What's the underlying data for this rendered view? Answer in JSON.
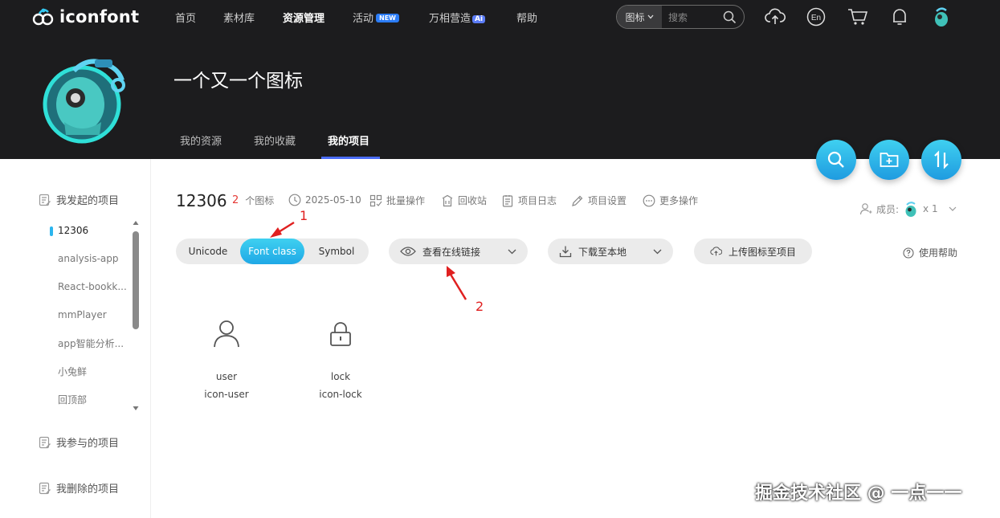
{
  "colors": {
    "nav_bg": "#1c1c1e",
    "accent_cyan": "#2bb5ee",
    "tab_underline": "#4a6cf7",
    "annotation_red": "#e02020",
    "count_red": "#e53935"
  },
  "nav": {
    "logo_text": "iconfont",
    "items": [
      "首页",
      "素材库",
      "资源管理",
      "活动",
      "万相营造",
      "帮助"
    ],
    "active_index": 2,
    "new_badge": "NEW",
    "ai_badge": "Ai",
    "search_type": "图标",
    "search_placeholder": "搜索",
    "icons": [
      "upload-icon",
      "language-en-icon",
      "cart-icon",
      "bell-icon",
      "user-avatar"
    ],
    "lang_label": "En"
  },
  "hero": {
    "title": "一个又一个图标",
    "tabs": [
      "我的资源",
      "我的收藏",
      "我的项目"
    ],
    "active_tab_index": 2
  },
  "fabs": [
    "search-icon",
    "add-folder-icon",
    "sort-icon"
  ],
  "sidebar": {
    "sections": {
      "initiated": "我发起的项目",
      "joined": "我参与的项目",
      "deleted": "我删除的项目"
    },
    "projects": [
      "12306",
      "analysis-app",
      "React-bookk...",
      "mmPlayer",
      "app智能分析...",
      "小兔鲜",
      "回顶部"
    ],
    "active_project_index": 0
  },
  "project": {
    "name": "12306",
    "icon_count": "2",
    "icon_count_label": "个图标",
    "date": "2025-05-10",
    "actions": [
      "批量操作",
      "回收站",
      "项目日志",
      "项目设置",
      "更多操作"
    ],
    "members_label": "成员:",
    "members_count": "x 1"
  },
  "toolbar": {
    "segments": [
      "Unicode",
      "Font class",
      "Symbol"
    ],
    "active_segment_index": 1,
    "view_link": "查看在线链接",
    "download": "下载至本地",
    "upload": "上传图标至项目",
    "help": "使用帮助"
  },
  "icons": [
    {
      "name": "user",
      "class": "icon-user",
      "glyph": "user-icon"
    },
    {
      "name": "lock",
      "class": "icon-lock",
      "glyph": "lock-icon"
    }
  ],
  "annotations": [
    "1",
    "2"
  ],
  "watermark": "掘金技术社区 @ 一点一一"
}
